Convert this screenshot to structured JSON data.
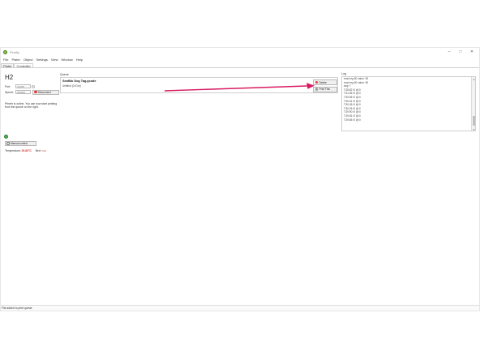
{
  "window": {
    "title": "Pinkfly",
    "minimize": "–",
    "maximize": "□",
    "close": "✕"
  },
  "menu": [
    "File",
    "Plater",
    "Object",
    "Settings",
    "View",
    "Window",
    "Help"
  ],
  "tabs": [
    "Plater",
    "Controller"
  ],
  "active_tab": "Controller",
  "printer": {
    "name": "H2",
    "port_label": "Port:",
    "port_value": "COM8",
    "speed_label": "Speed:",
    "speed_value": "250000",
    "disconnect_label": "Disconnect",
    "status_text": "Printer is online. You can now start printing from the queue on the right.",
    "manual_control_label": "Manual control",
    "temperature_label": "Temperature:",
    "temperature_value": "29.82°C",
    "bed_label": "Bed:",
    "bed_value": "n.a."
  },
  "queue": {
    "label": "Queue",
    "item_title": "Seaflkk Dog Tag.gcode",
    "item_subtitle": "Untitled (0.01m)",
    "delete_label": "Delete",
    "print_label": "Print This"
  },
  "log": {
    "label": "Log",
    "lines": [
      "read reg 50 value: 50",
      "read reg 50 value: 50",
      "stop 7",
      "T:28.82 /0 @:0",
      "T:31.55 /0 @:0",
      "T:30.56 /0 @:0",
      "T:30.61 /0 @:0",
      "T:30.45 /0 @:0",
      "T:30.26 /0 @:0",
      "T:29.90 /0 @:0",
      "T:29.81 /0 @:0",
      "T:29.65 /0 @:0"
    ]
  },
  "statusbar": {
    "text": "File added to print queue"
  },
  "colors": {
    "accent_red": "#d32f2f",
    "arrow": "#d81b60",
    "online_green": "#4caf50"
  },
  "icons": {
    "app": "app-logo-icon",
    "disconnect": "disconnect-red-icon",
    "manual_control": "manual-control-icon",
    "delete": "delete-red-icon",
    "print": "print-icon",
    "status": "online-status-icon"
  }
}
